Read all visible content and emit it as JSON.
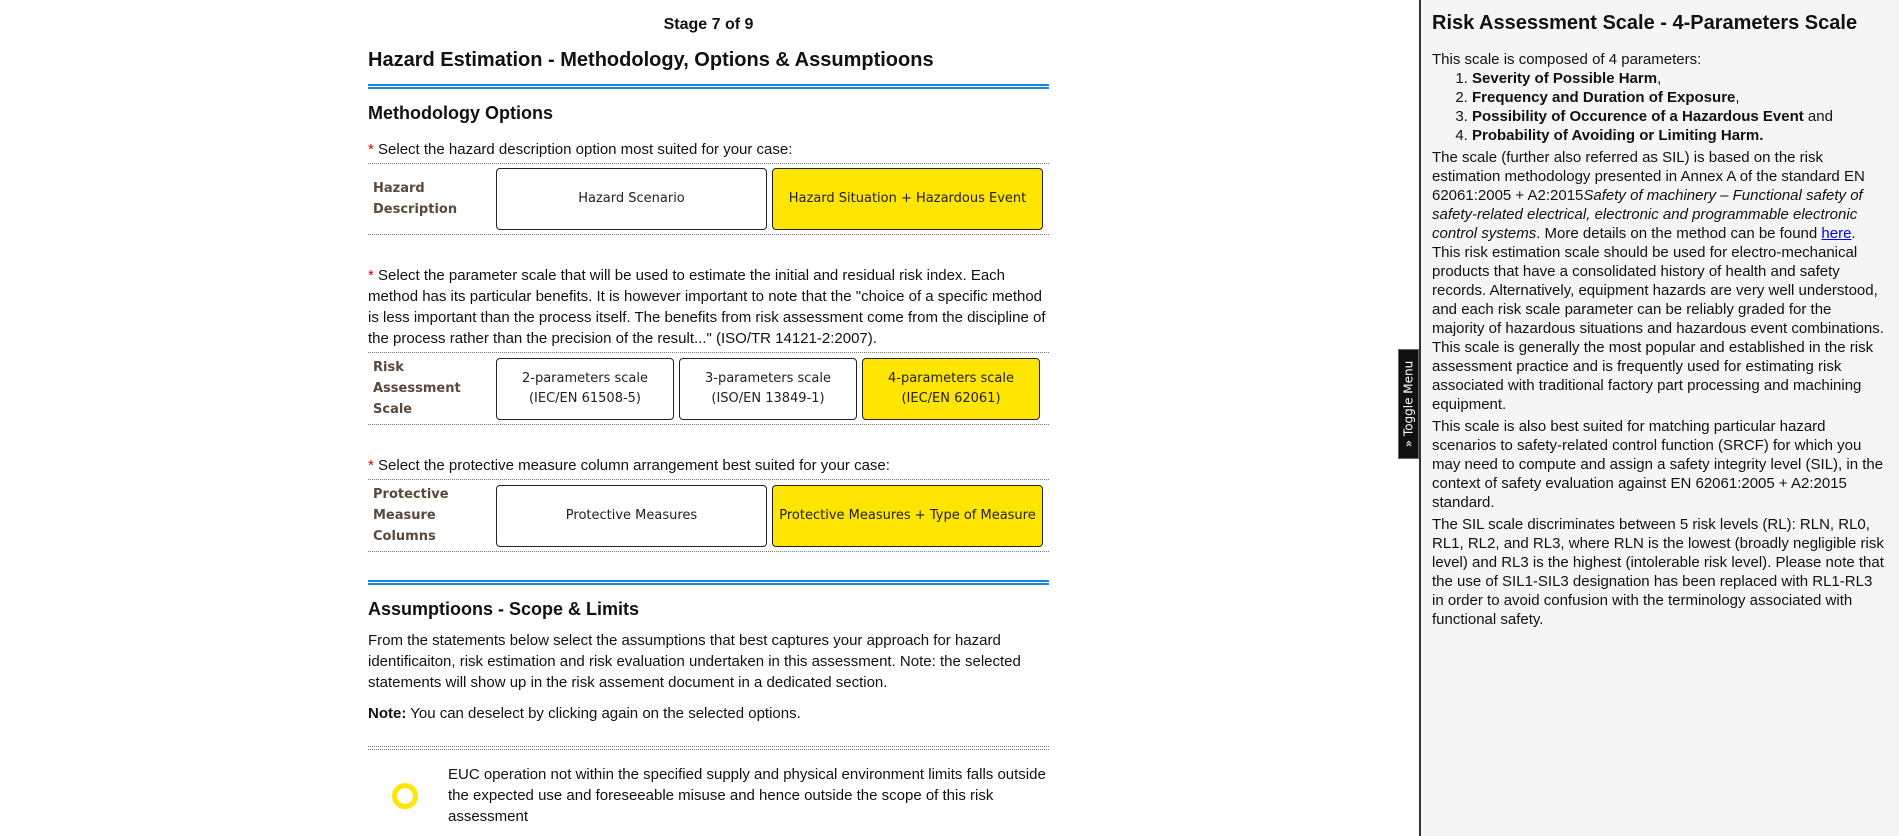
{
  "stage": "Stage 7 of 9",
  "page_title": "Hazard Estimation - Methodology, Options & Assumptioons",
  "methodology": {
    "heading": "Methodology Options",
    "required_mark": "*",
    "hazard_description": {
      "prompt": "Select the hazard description option most suited for your case:",
      "label": "Hazard Description",
      "options": [
        {
          "label": "Hazard Scenario",
          "selected": false
        },
        {
          "label": "Hazard Situation + Hazardous Event",
          "selected": true
        }
      ]
    },
    "risk_scale": {
      "prompt": "Select the parameter scale that will be used to estimate the initial and residual risk index. Each method has its particular benefits. It is however important to note that the \"choice of a specific method is less important than the process itself. The benefits from risk assessment come from the discipline of the process rather than the precision of the result...\" (ISO/TR 14121-2:2007).",
      "label": "Risk Assessment Scale",
      "options": [
        {
          "line1": "2-parameters scale",
          "line2": "(IEC/EN 61508-5)",
          "selected": false
        },
        {
          "line1": "3-parameters scale",
          "line2": "(ISO/EN 13849-1)",
          "selected": false
        },
        {
          "line1": "4-parameters scale",
          "line2": "(IEC/EN 62061)",
          "selected": true
        }
      ]
    },
    "protective_columns": {
      "prompt": "Select the protective measure column arrangement best suited for your case:",
      "label": "Protective Measure Columns",
      "options": [
        {
          "label": "Protective Measures",
          "selected": false
        },
        {
          "label": "Protective Measures + Type of Measure",
          "selected": true
        }
      ]
    }
  },
  "assumptions": {
    "heading": "Assumptioons - Scope & Limits",
    "intro": "From the statements below select the assumptions that best captures your approach for hazard identificaiton, risk estimation and risk evaluation undertaken in this assessment. Note: the selected statements will show up in the risk assement document in a dedicated section.",
    "note_label": "Note:",
    "note_text": " You can deselect by clicking again on the selected options.",
    "items": [
      {
        "text": "EUC operation not within the specified supply and physical environment limits falls outside the expected use and foreseeable misuse and hence outside the scope of this risk assessment",
        "selected": false
      }
    ]
  },
  "toggle_menu": {
    "label": "Toggle Menu",
    "icon": "double-chevron-icon",
    "glyph": "»"
  },
  "side_panel": {
    "title": "Risk Assessment Scale - 4-Parameters Scale",
    "intro": "This scale is composed of 4 parameters:",
    "parameters": [
      {
        "bold": "Severity of Possible Harm",
        "after": ","
      },
      {
        "bold": "Frequency and Duration of Exposure",
        "after": ","
      },
      {
        "bold": "Possibility of Occurence of a Hazardous Event",
        "after": " and"
      },
      {
        "bold": "Probability of Avoiding or Limiting Harm.",
        "after": ""
      }
    ],
    "p1_a": "The scale (further also referred as SIL) is based on the risk estimation methodology presented in Annex A of the standard EN 62061:2005 + A2:2015",
    "p1_italic": "Safety of machinery – Functional safety of safety-related electrical, electronic and programmable electronic control systems",
    "p1_b": ". More details on the method can be found ",
    "p1_link": "here",
    "p1_c": ".",
    "p2": "This risk estimation scale should be used for electro-mechanical products that have a consolidated history of health and safety records. Alternatively, equipment hazards are very well understood, and each risk scale parameter can be reliably graded for the majority of hazardous situations and hazardous event combinations. This scale is generally the most popular and established in the risk assessment practice and is frequently used for estimating risk associated with traditional factory part processing and machining equipment.",
    "p3": "This scale is also best suited for matching particular hazard scenarios to safety-related control function (SRCF) for which you may need to compute and assign a safety integrity level (SIL), in the context of safety evaluation against EN 62061:2005 + A2:2015 standard.",
    "p4": "The SIL scale discriminates between 5 risk levels (RL): RLN, RL0, RL1, RL2, and RL3, where RLN is the lowest (broadly negligible risk level) and RL3 is the highest (intolerable risk level). Please note that the use of SIL1-SIL3 designation has been replaced with RL1-RL3 in order to avoid confusion with the terminology associated with functional safety."
  },
  "colors": {
    "accent": "#1e88d8",
    "selected": "#ffe500",
    "required": "#dd0000"
  }
}
